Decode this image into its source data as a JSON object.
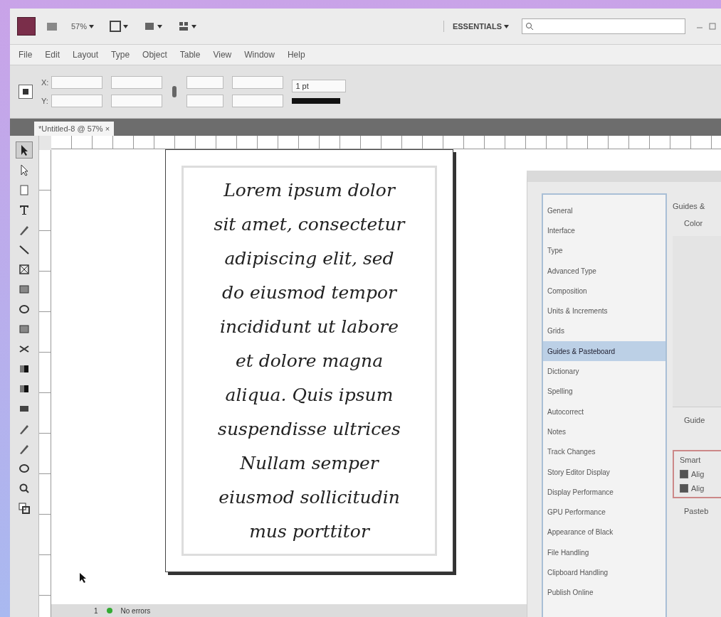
{
  "app_bar": {
    "zoom": "57%",
    "workspace": "ESSENTIALS"
  },
  "menu": [
    "File",
    "Edit",
    "Layout",
    "Type",
    "Object",
    "Table",
    "View",
    "Window",
    "Help"
  ],
  "control_panel": {
    "x_label": "X:",
    "y_label": "Y:",
    "stroke_weight": "1 pt"
  },
  "document_tab": {
    "title": "*Untitled-8 @ 57%",
    "close": "×"
  },
  "tools": [
    {
      "kind": "arrow",
      "selected": true
    },
    {
      "kind": "arrow-hollow",
      "selected": false
    },
    {
      "kind": "page",
      "selected": false
    },
    {
      "kind": "type",
      "selected": false
    },
    {
      "kind": "pen",
      "selected": false
    },
    {
      "kind": "line",
      "selected": false
    },
    {
      "kind": "frame",
      "selected": false
    },
    {
      "kind": "rect",
      "selected": false
    },
    {
      "kind": "ellipse",
      "selected": false
    },
    {
      "kind": "rect",
      "selected": false
    },
    {
      "kind": "scissors",
      "selected": false
    },
    {
      "kind": "gradient",
      "selected": false
    },
    {
      "kind": "gradient",
      "selected": false
    },
    {
      "kind": "note",
      "selected": false
    },
    {
      "kind": "pen",
      "selected": false
    },
    {
      "kind": "pen",
      "selected": false
    },
    {
      "kind": "ellipse",
      "selected": false
    },
    {
      "kind": "zoom",
      "selected": false
    },
    {
      "kind": "fill",
      "selected": false
    }
  ],
  "page_text": [
    "Lorem ipsum dolor",
    "sit amet, consectetur",
    "adipiscing elit, sed",
    "do eiusmod tempor",
    "incididunt ut labore",
    "et dolore magna",
    "aliqua. Quis ipsum",
    "suspendisse ultrices",
    "Nullam semper",
    "eiusmod sollicitudin",
    "mus porttitor"
  ],
  "status_bar": {
    "page": "1",
    "preflight": "No errors"
  },
  "preferences": {
    "categories": [
      {
        "label": "General",
        "selected": false
      },
      {
        "label": "Interface",
        "selected": false
      },
      {
        "label": "Type",
        "selected": false
      },
      {
        "label": "Advanced Type",
        "selected": false
      },
      {
        "label": "Composition",
        "selected": false
      },
      {
        "label": "Units & Increments",
        "selected": false
      },
      {
        "label": "Grids",
        "selected": false
      },
      {
        "label": "Guides & Pasteboard",
        "selected": true
      },
      {
        "label": "Dictionary",
        "selected": false
      },
      {
        "label": "Spelling",
        "selected": false
      },
      {
        "label": "Autocorrect",
        "selected": false
      },
      {
        "label": "Notes",
        "selected": false
      },
      {
        "label": "Track Changes",
        "selected": false
      },
      {
        "label": "Story Editor Display",
        "selected": false
      },
      {
        "label": "Display Performance",
        "selected": false
      },
      {
        "label": "GPU Performance",
        "selected": false
      },
      {
        "label": "Appearance of Black",
        "selected": false
      },
      {
        "label": "File Handling",
        "selected": false
      },
      {
        "label": "Clipboard Handling",
        "selected": false
      },
      {
        "label": "Publish Online",
        "selected": false
      }
    ],
    "heading": "Guides &",
    "color_label": "Color",
    "guide_label": "Guide",
    "smart_group": {
      "title": "Smart",
      "options": [
        {
          "label": "Alig",
          "checked": true
        },
        {
          "label": "Alig",
          "checked": true
        }
      ]
    },
    "pasteboard_label": "Pasteb"
  }
}
